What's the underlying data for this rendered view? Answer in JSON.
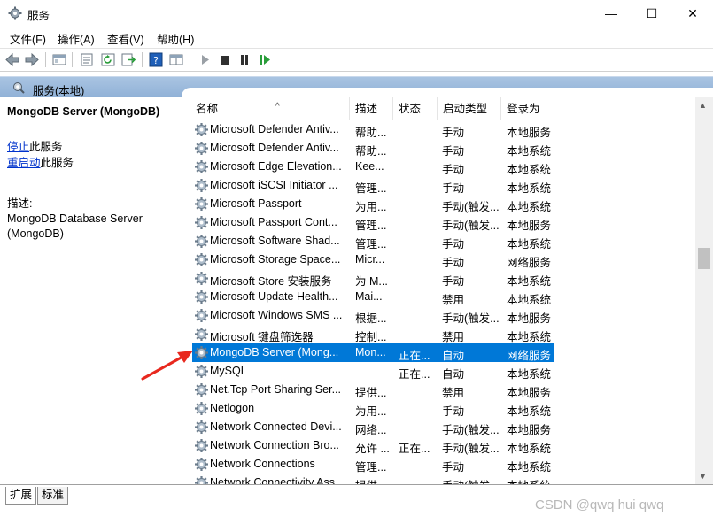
{
  "window": {
    "title": "服务",
    "min": "—",
    "max": "☐",
    "close": "✕"
  },
  "menu": [
    "文件(F)",
    "操作(A)",
    "查看(V)",
    "帮助(H)"
  ],
  "pane_header": {
    "title": "服务(本地)"
  },
  "left_panel": {
    "service_title": "MongoDB Server (MongoDB)",
    "stop_link": "停止",
    "stop_suffix": "此服务",
    "restart_link": "重启动",
    "restart_suffix": "此服务",
    "desc_label": "描述:",
    "desc_line1": "MongoDB Database Server",
    "desc_line2": "(MongoDB)"
  },
  "table": {
    "columns": [
      "名称",
      "描述",
      "状态",
      "启动类型",
      "登录为"
    ],
    "rows": [
      {
        "name": "Microsoft Defender Antiv...",
        "desc": "帮助...",
        "status": "",
        "type": "手动",
        "logon": "本地服务"
      },
      {
        "name": "Microsoft Defender Antiv...",
        "desc": "帮助...",
        "status": "",
        "type": "手动",
        "logon": "本地系统"
      },
      {
        "name": "Microsoft Edge Elevation...",
        "desc": "Kee...",
        "status": "",
        "type": "手动",
        "logon": "本地系统"
      },
      {
        "name": "Microsoft iSCSI Initiator ...",
        "desc": "管理...",
        "status": "",
        "type": "手动",
        "logon": "本地系统"
      },
      {
        "name": "Microsoft Passport",
        "desc": "为用...",
        "status": "",
        "type": "手动(触发...",
        "logon": "本地系统"
      },
      {
        "name": "Microsoft Passport Cont...",
        "desc": "管理...",
        "status": "",
        "type": "手动(触发...",
        "logon": "本地服务"
      },
      {
        "name": "Microsoft Software Shad...",
        "desc": "管理...",
        "status": "",
        "type": "手动",
        "logon": "本地系统"
      },
      {
        "name": "Microsoft Storage Space...",
        "desc": "Micr...",
        "status": "",
        "type": "手动",
        "logon": "网络服务"
      },
      {
        "name": "Microsoft Store 安装服务",
        "desc": "为 M...",
        "status": "",
        "type": "手动",
        "logon": "本地系统"
      },
      {
        "name": "Microsoft Update Health...",
        "desc": "Mai...",
        "status": "",
        "type": "禁用",
        "logon": "本地系统"
      },
      {
        "name": "Microsoft Windows SMS ...",
        "desc": "根据...",
        "status": "",
        "type": "手动(触发...",
        "logon": "本地服务"
      },
      {
        "name": "Microsoft 键盘筛选器",
        "desc": "控制...",
        "status": "",
        "type": "禁用",
        "logon": "本地系统"
      },
      {
        "name": "MongoDB Server (Mong...",
        "desc": "Mon...",
        "status": "正在...",
        "type": "自动",
        "logon": "网络服务",
        "selected": true
      },
      {
        "name": "MySQL",
        "desc": "",
        "status": "正在...",
        "type": "自动",
        "logon": "本地系统"
      },
      {
        "name": "Net.Tcp Port Sharing Ser...",
        "desc": "提供...",
        "status": "",
        "type": "禁用",
        "logon": "本地服务"
      },
      {
        "name": "Netlogon",
        "desc": "为用...",
        "status": "",
        "type": "手动",
        "logon": "本地系统"
      },
      {
        "name": "Network Connected Devi...",
        "desc": "网络...",
        "status": "",
        "type": "手动(触发...",
        "logon": "本地服务"
      },
      {
        "name": "Network Connection Bro...",
        "desc": "允许 ...",
        "status": "正在...",
        "type": "手动(触发...",
        "logon": "本地系统"
      },
      {
        "name": "Network Connections",
        "desc": "管理...",
        "status": "",
        "type": "手动",
        "logon": "本地系统"
      },
      {
        "name": "Network Connectivity Ass...",
        "desc": "提供...",
        "status": "",
        "type": "手动(触发...",
        "logon": "本地系统"
      }
    ]
  },
  "tabs": [
    "扩展",
    "标准"
  ],
  "watermark": "CSDN @qwq hui qwq",
  "colors": {
    "selection": "#0078d7",
    "link": "#0033cc",
    "arrow": "#e8281e",
    "header": "#9fbde0"
  }
}
